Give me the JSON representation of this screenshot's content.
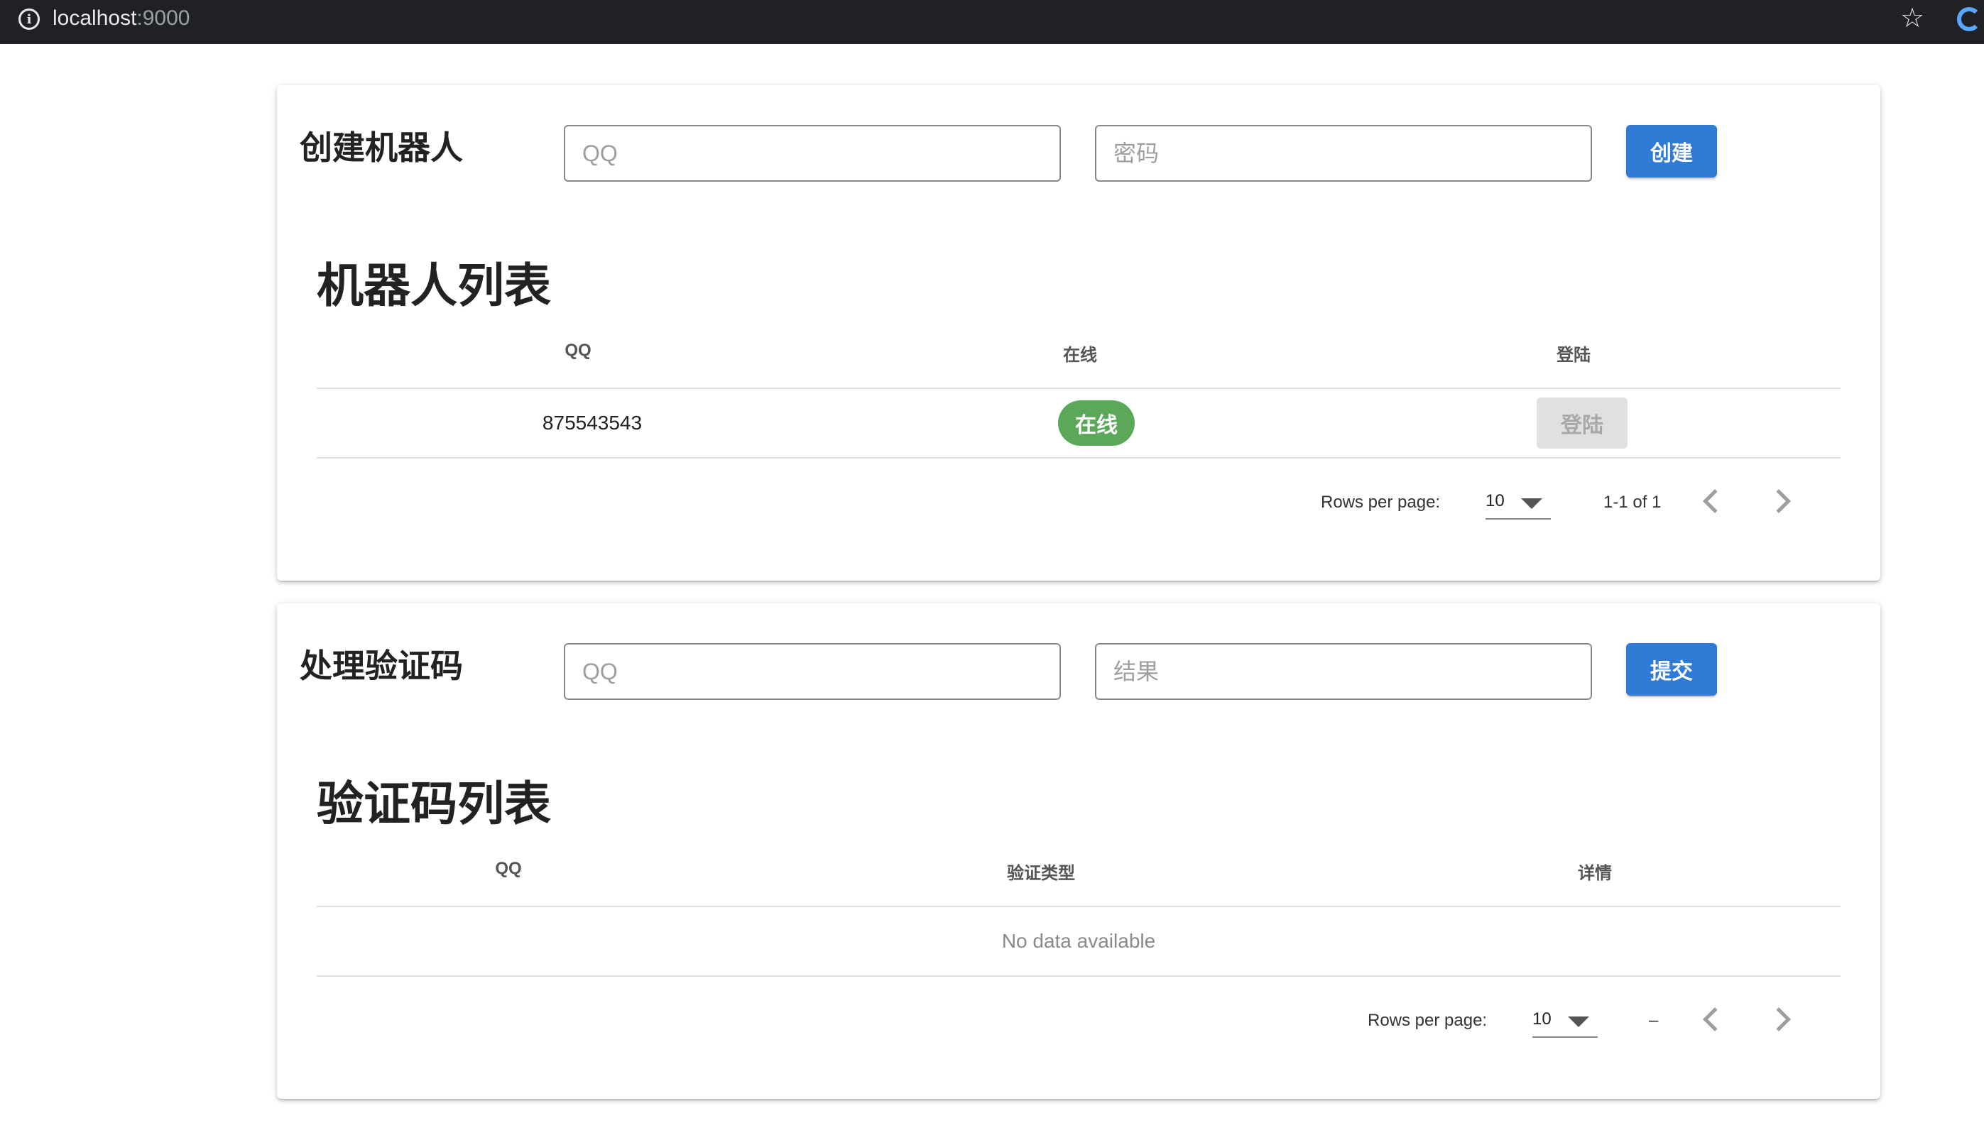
{
  "browser": {
    "url_host": "localhost",
    "url_port": ":9000"
  },
  "bot_section": {
    "form_title": "创建机器人",
    "qq_placeholder": "QQ",
    "password_placeholder": "密码",
    "create_button": "创建",
    "list_title": "机器人列表",
    "columns": [
      "QQ",
      "在线",
      "登陆"
    ],
    "rows": [
      {
        "qq": "875543543",
        "status": "在线",
        "login_label": "登陆"
      }
    ],
    "footer": {
      "rows_per_page_label": "Rows per page:",
      "rows_per_page_value": "10",
      "range": "1-1 of 1"
    }
  },
  "captcha_section": {
    "form_title": "处理验证码",
    "qq_placeholder": "QQ",
    "result_placeholder": "结果",
    "submit_button": "提交",
    "list_title": "验证码列表",
    "columns": [
      "QQ",
      "验证类型",
      "详情"
    ],
    "empty_text": "No data available",
    "footer": {
      "rows_per_page_label": "Rows per page:",
      "rows_per_page_value": "10",
      "range": "–"
    }
  },
  "colors": {
    "primary": "#2f7bd6",
    "online_chip": "#5ba85a",
    "disabled_button": "#e0e0e0"
  }
}
